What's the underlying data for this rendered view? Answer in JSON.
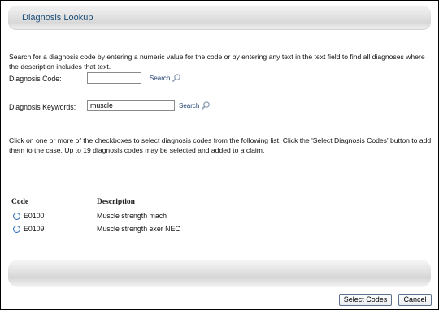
{
  "header": {
    "title": "Diagnosis Lookup"
  },
  "intro_text": "Search for a diagnosis code by entering a numeric value for the code or by entering any text in the text field to find all diagnoses where the description includes that text.",
  "code_search": {
    "label": "Diagnosis Code:",
    "value": "",
    "search_label": "Search"
  },
  "keyword_search": {
    "label": "Diagnosis Keywords:",
    "value": "muscle",
    "search_label": "Search"
  },
  "info_text": "Click on one or more of the checkboxes to select diagnosis codes from the following list. Click the 'Select Diagnosis Codes' button to add them to the case. Up to 19 diagnosis codes may be selected and added to a claim.",
  "results": {
    "columns": {
      "code": "Code",
      "description": "Description"
    },
    "rows": [
      {
        "code": "E0100",
        "description": "Muscle strength mach"
      },
      {
        "code": "E0109",
        "description": "Muscle strength exer NEC"
      }
    ]
  },
  "buttons": {
    "select": "Select Codes",
    "cancel": "Cancel"
  },
  "icons": {
    "search": "magnifier-icon",
    "row_select": "radio-icon"
  }
}
